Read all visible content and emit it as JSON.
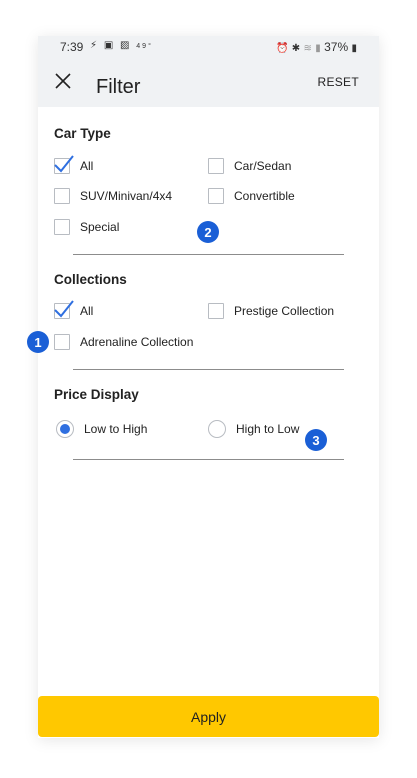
{
  "status_bar": {
    "time": "7:39",
    "temperature": "49°",
    "battery": "37%",
    "left_icons": [
      "usb-icon",
      "app-icon",
      "image-icon"
    ],
    "right_icons": [
      "alarm-icon",
      "bluetooth-icon",
      "wifi-icon",
      "signal-icon",
      "battery-icon"
    ]
  },
  "header": {
    "title": "Filter",
    "reset_label": "RESET"
  },
  "car_type": {
    "title": "Car Type",
    "options": [
      {
        "label": "All",
        "checked": true
      },
      {
        "label": "Car/Sedan",
        "checked": false
      },
      {
        "label": "SUV/Minivan/4x4",
        "checked": false
      },
      {
        "label": "Convertible",
        "checked": false
      },
      {
        "label": "Special",
        "checked": false
      }
    ]
  },
  "collections": {
    "title": "Collections",
    "options": [
      {
        "label": "All",
        "checked": true
      },
      {
        "label": "Prestige Collection",
        "checked": false
      },
      {
        "label": "Adrenaline Collection",
        "checked": false
      }
    ]
  },
  "price_display": {
    "title": "Price Display",
    "options": [
      {
        "label": "Low to High",
        "selected": true
      },
      {
        "label": "High to Low",
        "selected": false
      }
    ]
  },
  "annotations": [
    "1",
    "2",
    "3"
  ],
  "apply_label": "Apply",
  "colors": {
    "accent": "#2f6fe0",
    "apply_button": "#ffc800",
    "badge": "#1a5fd6",
    "header_bg": "#f0f2f4"
  }
}
